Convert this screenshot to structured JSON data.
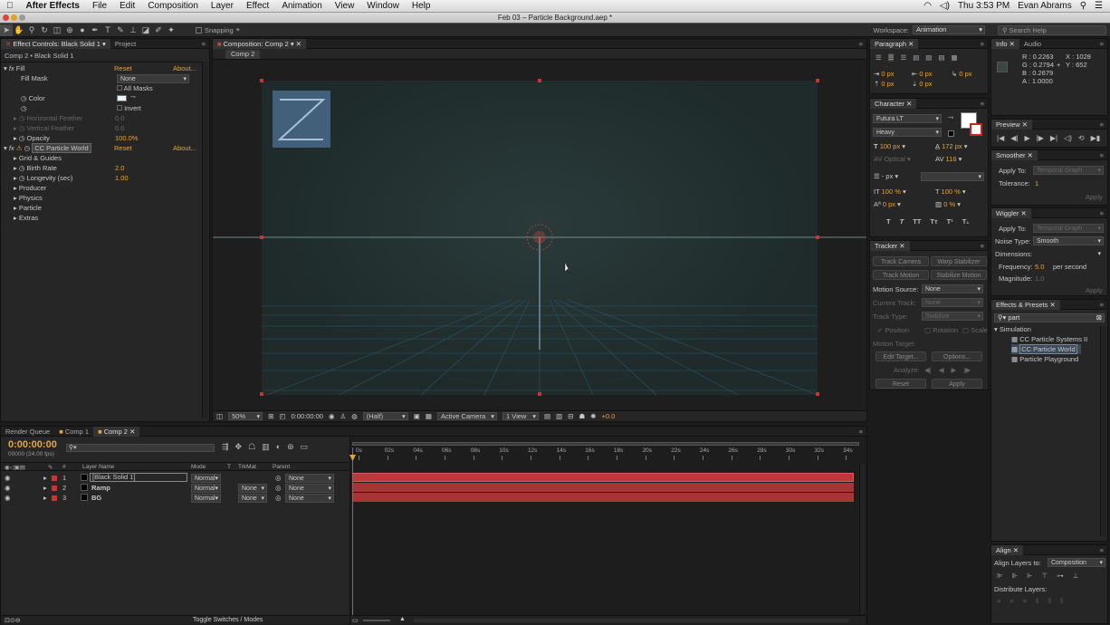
{
  "menubar": {
    "app_name": "After Effects",
    "items": [
      "File",
      "Edit",
      "Composition",
      "Layer",
      "Effect",
      "Animation",
      "View",
      "Window",
      "Help"
    ],
    "clock": "Thu 3:53 PM",
    "user": "Evan Abrams"
  },
  "titlebar": {
    "title": "Feb 03 – Particle Background.aep *"
  },
  "toolbar": {
    "snapping_label": "Snapping",
    "workspace_label": "Workspace:",
    "workspace_value": "Animation",
    "search_placeholder": "Search Help"
  },
  "effect_controls": {
    "tab_label": "Effect Controls: Black Solid 1",
    "project_tab": "Project",
    "breadcrumb": "Comp 2 • Black Solid 1",
    "fill": {
      "name": "Fill",
      "reset": "Reset",
      "about": "About...",
      "fill_mask_label": "Fill Mask",
      "fill_mask_value": "None",
      "all_masks": "All Masks",
      "color_label": "Color",
      "invert": "Invert",
      "h_feather": "Horizontal Feather",
      "h_feather_val": "0.0",
      "v_feather": "Vertical Feather",
      "v_feather_val": "0.0",
      "opacity": "Opacity",
      "opacity_val": "100.0%"
    },
    "particle": {
      "name": "CC Particle World",
      "reset": "Reset",
      "about": "About...",
      "grid": "Grid & Guides",
      "birth_rate": "Birth Rate",
      "birth_rate_val": "2.0",
      "longevity": "Longevity (sec)",
      "longevity_val": "1.00",
      "producer": "Producer",
      "physics": "Physics",
      "particle": "Particle",
      "extras": "Extras"
    }
  },
  "composition": {
    "tab_label": "Composition: Comp 2",
    "sub_tab": "Comp 2",
    "zoom": "50%",
    "timecode": "0:00:00:00",
    "resolution": "(Half)",
    "camera": "Active Camera",
    "views": "1 View",
    "exposure": "+0.0"
  },
  "paragraph": {
    "tab": "Paragraph",
    "fields": [
      "0 px",
      "0 px",
      "0 px",
      "0 px",
      "0 px"
    ]
  },
  "character": {
    "tab": "Character",
    "font": "Futura LT",
    "style": "Heavy",
    "size": "100 px",
    "leading": "172 px",
    "kerning": "Optical",
    "tracking": "116",
    "stroke": "- px",
    "vscale": "100 %",
    "hscale": "100 %",
    "baseline": "0 px",
    "tsume": "0 %"
  },
  "tracker": {
    "tab": "Tracker",
    "track_camera": "Track Camera",
    "warp_stabilizer": "Warp Stabilizer",
    "track_motion": "Track Motion",
    "stabilize_motion": "Stabilize Motion",
    "motion_source_label": "Motion Source:",
    "motion_source": "None",
    "current_track_label": "Current Track:",
    "current_track": "None",
    "track_type_label": "Track Type:",
    "track_type": "Stabilize",
    "position": "Position",
    "rotation": "Rotation",
    "scale": "Scale",
    "motion_target": "Motion Target:",
    "edit_target": "Edit Target...",
    "options": "Options...",
    "analyze": "Analyze:",
    "reset": "Reset",
    "apply": "Apply"
  },
  "info": {
    "tab": "Info",
    "audio_tab": "Audio",
    "r": "R : 0.2263",
    "g": "G : 0.2794",
    "b": "B : 0.2679",
    "a": "A : 1.0000",
    "x": "X : 1028",
    "y": "Y : 652"
  },
  "preview": {
    "tab": "Preview"
  },
  "smoother": {
    "tab": "Smoother",
    "apply_to_label": "Apply To:",
    "apply_to": "Temporal Graph",
    "tolerance_label": "Tolerance:",
    "tolerance": "1",
    "apply": "Apply"
  },
  "wiggler": {
    "tab": "Wiggler",
    "apply_to_label": "Apply To:",
    "apply_to": "Temporal Graph",
    "noise_label": "Noise Type:",
    "noise": "Smooth",
    "dimensions_label": "Dimensions:",
    "frequency_label": "Frequency:",
    "frequency": "5.0",
    "per_second": "per second",
    "magnitude_label": "Magnitude:",
    "magnitude": "1.0",
    "apply": "Apply"
  },
  "effects_presets": {
    "tab": "Effects & Presets",
    "search": "part",
    "category": "Simulation",
    "items": [
      "CC Particle Systems II",
      "CC Particle World",
      "Particle Playground"
    ]
  },
  "align": {
    "tab": "Align",
    "align_to_label": "Align Layers to:",
    "align_to": "Composition",
    "distribute": "Distribute Layers:"
  },
  "timeline": {
    "tabs": [
      "Render Queue",
      "Comp 1",
      "Comp 2"
    ],
    "timecode": "0:00:00:00",
    "frames": "00000 (24.00 fps)",
    "col_hash": "#",
    "col_layer": "Layer Name",
    "col_mode": "Mode",
    "col_t": "T",
    "col_trkmat": "TrkMat",
    "col_parent": "Parent",
    "ruler": [
      "0s",
      "02s",
      "04s",
      "06s",
      "08s",
      "10s",
      "12s",
      "14s",
      "16s",
      "18s",
      "20s",
      "22s",
      "24s",
      "26s",
      "28s",
      "30s",
      "32s",
      "34s"
    ],
    "layers": [
      {
        "num": "1",
        "name": "[Black Solid 1]",
        "mode": "Normal",
        "trkmat": "",
        "parent": "None",
        "color": "#c33"
      },
      {
        "num": "2",
        "name": "Ramp",
        "mode": "Normal",
        "trkmat": "None",
        "parent": "None",
        "color": "#c33"
      },
      {
        "num": "3",
        "name": "BG",
        "mode": "Normal",
        "trkmat": "None",
        "parent": "None",
        "color": "#c33"
      }
    ],
    "toggle": "Toggle Switches / Modes"
  }
}
